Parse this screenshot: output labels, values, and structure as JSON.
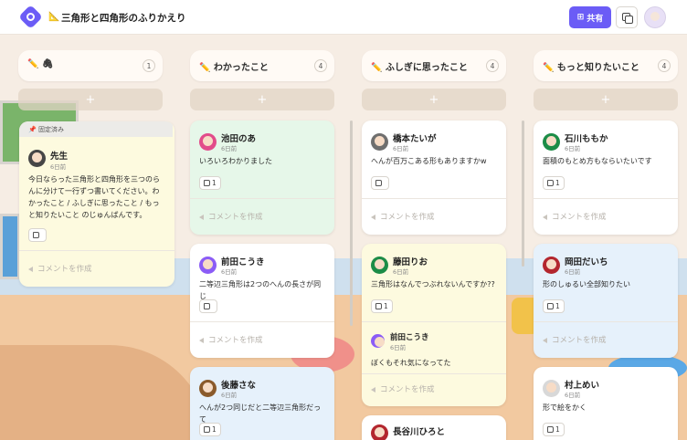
{
  "header": {
    "board_icon": "📐",
    "title": "三角形と四角形のふりかえり",
    "share_label": "共有",
    "share_icon": "⊞"
  },
  "colors": {
    "accent": "#6b5cf6",
    "card_green": "#e6f7e9",
    "card_yellow": "#fdfadf",
    "card_blue": "#e6f1fb"
  },
  "columns": [
    {
      "title": "✏️ 🖇",
      "count": "1",
      "add_label": "+",
      "cards": [
        {
          "pinned_label": "固定済み",
          "pin_icon": "📌",
          "name": "先生",
          "time": "6日前",
          "text": "今日ならった三角形と四角形を三つのらんに分けて一行ずつ書いてください。わかったこと / ふしぎに思ったこと / もっと知りたいこと のじゅんばんです。",
          "likes": "",
          "comment": "コメントを作成"
        }
      ]
    },
    {
      "title": "✏️ わかったこと",
      "count": "4",
      "add_label": "+",
      "cards": [
        {
          "name": "池田のあ",
          "time": "6日前",
          "text": "いろいろわかりました",
          "likes": "1",
          "comment": "コメントを作成"
        },
        {
          "name": "前田こうき",
          "time": "6日前",
          "text": "二等辺三角形は2つのへんの長さが同じ",
          "likes": "",
          "comment": "コメントを作成"
        },
        {
          "name": "後藤さな",
          "time": "6日前",
          "text": "へんが2つ同じだと二等辺三角形だって",
          "likes": "1",
          "comment": ""
        }
      ]
    },
    {
      "title": "✏️ ふしぎに思ったこと",
      "count": "4",
      "add_label": "+",
      "cards": [
        {
          "name": "橋本たいが",
          "time": "6日前",
          "text": "へんが百万こある形もありますかw",
          "likes": "",
          "comment": "コメントを作成"
        },
        {
          "name": "藤田りお",
          "time": "6日前",
          "text": "三角形はなんでつぶれないんですか??",
          "likes": "1",
          "reply": {
            "name": "前田こうき",
            "time": "6日前",
            "text": "ぼくもそれ気になってた"
          },
          "comment": "コメントを作成"
        },
        {
          "name": "長谷川ひろと",
          "time": "",
          "text": "",
          "likes": "",
          "comment": ""
        }
      ]
    },
    {
      "title": "✏️ もっと知りたいこと",
      "count": "4",
      "add_label": "+",
      "cards": [
        {
          "name": "石川ももか",
          "time": "6日前",
          "text": "面積のもとめ方もならいたいです",
          "likes": "1",
          "comment": "コメントを作成"
        },
        {
          "name": "岡田だいち",
          "time": "6日前",
          "text": "形のしゅるい全部知りたい",
          "likes": "1",
          "comment": "コメントを作成"
        },
        {
          "name": "村上めい",
          "time": "6日前",
          "text": "形で絵をかく",
          "likes": "1",
          "comment": ""
        }
      ]
    }
  ]
}
